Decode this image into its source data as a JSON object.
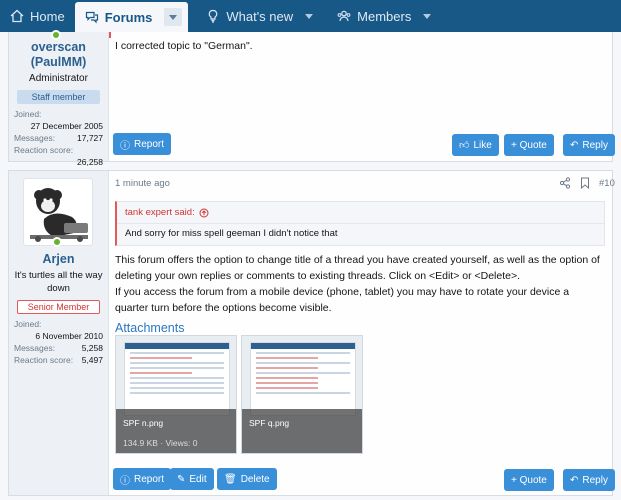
{
  "nav": {
    "home": "Home",
    "forums": "Forums",
    "whats_new": "What's new",
    "members": "Members"
  },
  "post1": {
    "username": "overscan (PaulMM)",
    "user_title": "Administrator",
    "badge": "Staff member",
    "joined_label": "Joined:",
    "joined_value": "27 December 2005",
    "messages_label": "Messages:",
    "messages_value": "17,727",
    "reaction_label": "Reaction score:",
    "reaction_value": "26,258",
    "body": "I corrected topic to \"German\".",
    "report": "Report",
    "like": "Like",
    "quote": "+ Quote",
    "reply": "Reply"
  },
  "post2": {
    "username": "Arjen",
    "user_title": "It's turtles all the way down",
    "badge": "Senior Member",
    "joined_label": "Joined:",
    "joined_value": "6 November 2010",
    "messages_label": "Messages:",
    "messages_value": "5,258",
    "reaction_label": "Reaction score:",
    "reaction_value": "5,497",
    "time": "1 minute ago",
    "post_number": "#10",
    "quote_author": "tank expert said:",
    "quote_text": "And sorry for miss spell geeman I didn't notice that",
    "body_p1": "This forum offers the option to change title of a thread you have created yourself, as well as the option of deleting your own replies or comments to existing threads. Click on <Edit> or <Delete>.",
    "body_p2": "If you access the forum from a mobile device (phone, tablet) you may have to rotate your device a quarter turn before the options become visible.",
    "attachments_title": "Attachments",
    "attachments": [
      {
        "name": "SPF n.png",
        "meta": "134.9 KB · Views: 0"
      },
      {
        "name": "SPF q.png",
        "meta": ""
      }
    ],
    "report": "Report",
    "edit": "Edit",
    "delete": "Delete",
    "quote": "+ Quote",
    "reply": "Reply"
  },
  "colors": {
    "nav_bg": "#185886",
    "button": "#3a8fd9",
    "link": "#2b5f8e",
    "senior_badge": "#d03535"
  }
}
